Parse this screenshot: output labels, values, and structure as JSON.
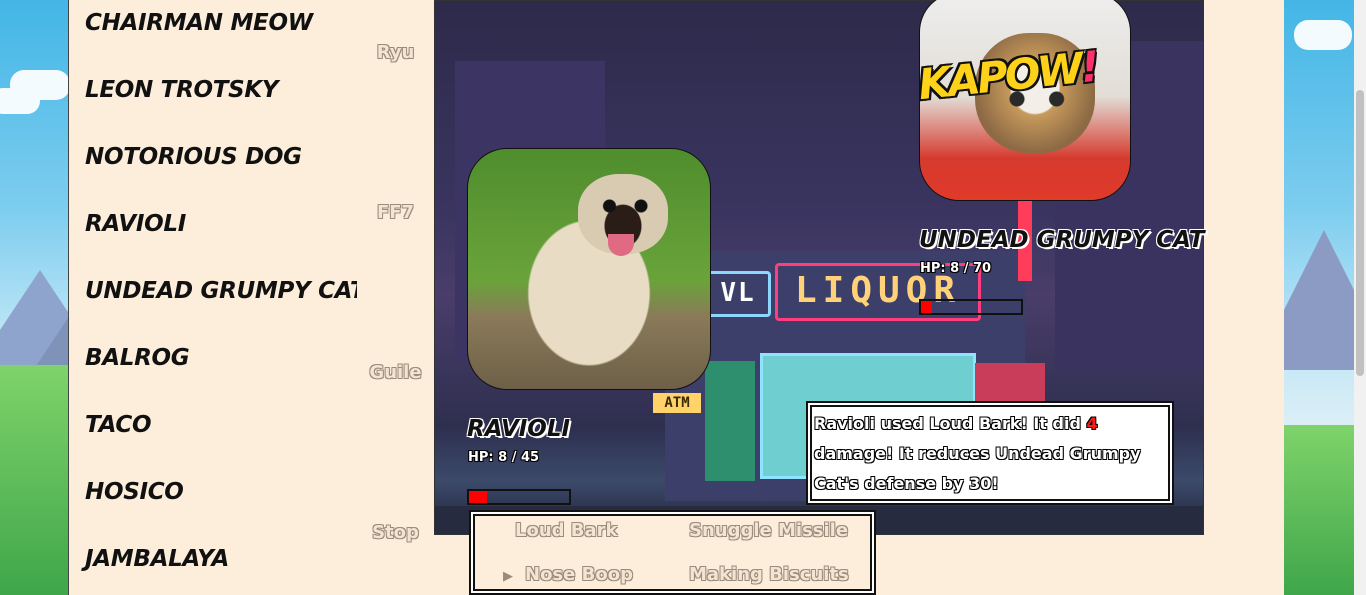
{
  "characters": [
    {
      "name": "CHAIRMAN MEOW"
    },
    {
      "name": "LEON TROTSKY"
    },
    {
      "name": "NOTORIOUS DOG"
    },
    {
      "name": "RAVIOLI"
    },
    {
      "name": "UNDEAD GRUMPY CAT"
    },
    {
      "name": "BALROG"
    },
    {
      "name": "TACO"
    },
    {
      "name": "HOSICO"
    },
    {
      "name": "JAMBALAYA"
    }
  ],
  "music": [
    "Ryu",
    "FF7",
    "Guile",
    "Stop"
  ],
  "scene_sign": {
    "left": "VL",
    "main": "LIQUOR",
    "atm": "ATM"
  },
  "player": {
    "name": "RAVIOLI",
    "hp_text": "HP: 8 / 45",
    "hp": 8,
    "hp_max": 45
  },
  "opponent": {
    "name": "UNDEAD GRUMPY CAT",
    "hp_text": "HP: 8 / 70",
    "hp": 8,
    "hp_max": 70,
    "overlay_text": "KAPOW!"
  },
  "battle_log": {
    "part1": "Ravioli used Loud Bark! It did ",
    "damage": "4",
    "part2": " damage! It reduces Undead Grumpy Cat's defense by 30!"
  },
  "moves": [
    "Loud Bark",
    "Snuggle Missile",
    "Nose Boop",
    "Making Biscuits"
  ],
  "selected_move_cursor": "▶",
  "colors": {
    "panel_bg": "#fdeedb",
    "hp_fill": "#ff0000",
    "damage": "#ff1a1a"
  }
}
